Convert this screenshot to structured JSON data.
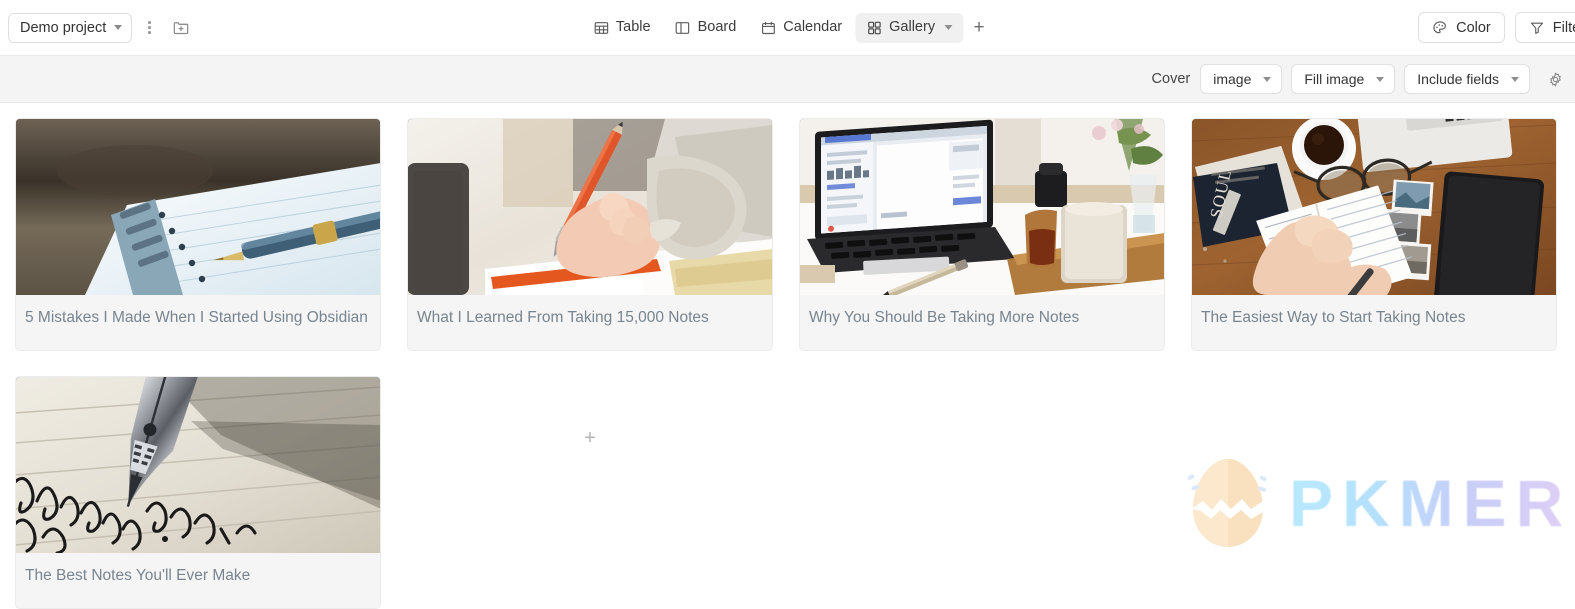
{
  "header": {
    "project_label": "Demo project",
    "more_menu_icon": "dots-vertical-icon",
    "new_folder_icon": "folder-plus-icon",
    "view_tabs": [
      {
        "label": "Table",
        "icon": "table-icon",
        "active": false
      },
      {
        "label": "Board",
        "icon": "board-icon",
        "active": false
      },
      {
        "label": "Calendar",
        "icon": "calendar-icon",
        "active": false
      },
      {
        "label": "Gallery",
        "icon": "gallery-grid-icon",
        "active": true
      }
    ],
    "add_view_label": "+",
    "color_button": {
      "label": "Color",
      "icon": "palette-icon"
    },
    "filter_button": {
      "label": "Filter",
      "icon": "funnel-icon"
    }
  },
  "sub_toolbar": {
    "cover_label": "Cover",
    "cover_value": "image",
    "fit_value": "Fill image",
    "fields_value": "Include fields",
    "settings_icon": "gear-icon"
  },
  "gallery": {
    "add_card_label": "+",
    "cards": [
      {
        "title": "5 Mistakes I Made When I Started Using Obsidian",
        "cover": "notebook-fountain-pen-wood"
      },
      {
        "title": "What I Learned From Taking 15,000 Notes",
        "cover": "hand-writing-red-pencil"
      },
      {
        "title": "Why You Should Be Taking More Notes",
        "cover": "laptop-desk-mug-flowers"
      },
      {
        "title": "The Easiest Way to Start Taking Notes",
        "cover": "overhead-desk-coffee-journal"
      },
      {
        "title": "The Best Notes You'll Ever Make",
        "cover": "fountain-pen-nib-cursive"
      }
    ]
  },
  "watermark": {
    "text": "PKMER",
    "logo_icon": "cracked-egg-icon"
  },
  "colors": {
    "card_title": "#78848f",
    "toolbar_bg": "#f4f4f4",
    "active_tab_bg": "#f0f0f0"
  }
}
